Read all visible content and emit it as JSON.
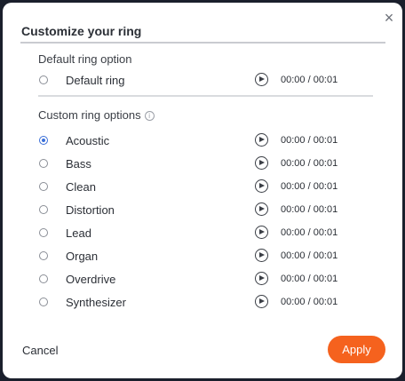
{
  "dialog": {
    "title": "Customize your ring",
    "close_glyph": "×",
    "close_icon": "close-icon"
  },
  "default_section": {
    "title": "Default ring option",
    "items": [
      {
        "label": "Default ring",
        "time": "00:00 / 00:01",
        "selected": false
      }
    ]
  },
  "custom_section": {
    "title": "Custom ring options",
    "info_glyph": "i",
    "items": [
      {
        "label": "Acoustic",
        "time": "00:00 / 00:01",
        "selected": true
      },
      {
        "label": "Bass",
        "time": "00:00 / 00:01",
        "selected": false
      },
      {
        "label": "Clean",
        "time": "00:00 / 00:01",
        "selected": false
      },
      {
        "label": "Distortion",
        "time": "00:00 / 00:01",
        "selected": false
      },
      {
        "label": "Lead",
        "time": "00:00 / 00:01",
        "selected": false
      },
      {
        "label": "Organ",
        "time": "00:00 / 00:01",
        "selected": false
      },
      {
        "label": "Overdrive",
        "time": "00:00 / 00:01",
        "selected": false
      },
      {
        "label": "Synthesizer",
        "time": "00:00 / 00:01",
        "selected": false
      }
    ]
  },
  "footer": {
    "cancel_label": "Cancel",
    "apply_label": "Apply"
  },
  "colors": {
    "accent": "#f5621e",
    "radio_selected": "#3b6fd8"
  }
}
